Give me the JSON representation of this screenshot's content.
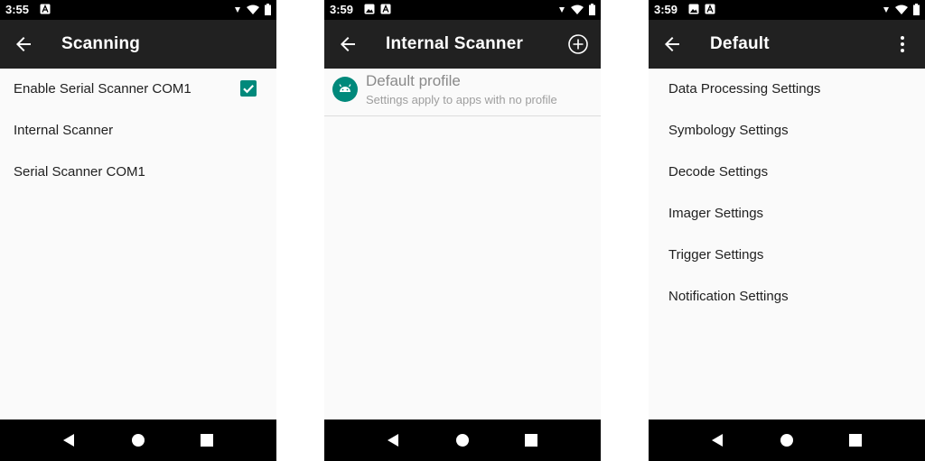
{
  "screens": [
    {
      "status": {
        "time": "3:55"
      },
      "appbar": {
        "title": "Scanning"
      },
      "items": [
        {
          "label": "Enable Serial Scanner COM1",
          "checked": true
        },
        {
          "label": "Internal Scanner"
        },
        {
          "label": "Serial Scanner COM1"
        }
      ]
    },
    {
      "status": {
        "time": "3:59"
      },
      "appbar": {
        "title": "Internal Scanner",
        "action_icon": "add-circle-icon"
      },
      "profile": {
        "title": "Default profile",
        "subtitle": "Settings apply to apps with no profile"
      }
    },
    {
      "status": {
        "time": "3:59"
      },
      "appbar": {
        "title": "Default",
        "action_icon": "more-vert-icon"
      },
      "items": [
        {
          "label": "Data Processing Settings"
        },
        {
          "label": "Symbology Settings"
        },
        {
          "label": "Decode Settings"
        },
        {
          "label": "Imager Settings"
        },
        {
          "label": "Trigger Settings"
        },
        {
          "label": "Notification Settings"
        }
      ]
    }
  ],
  "colors": {
    "accent": "#00897b",
    "appbar": "#212121",
    "system_bar": "#000000"
  }
}
